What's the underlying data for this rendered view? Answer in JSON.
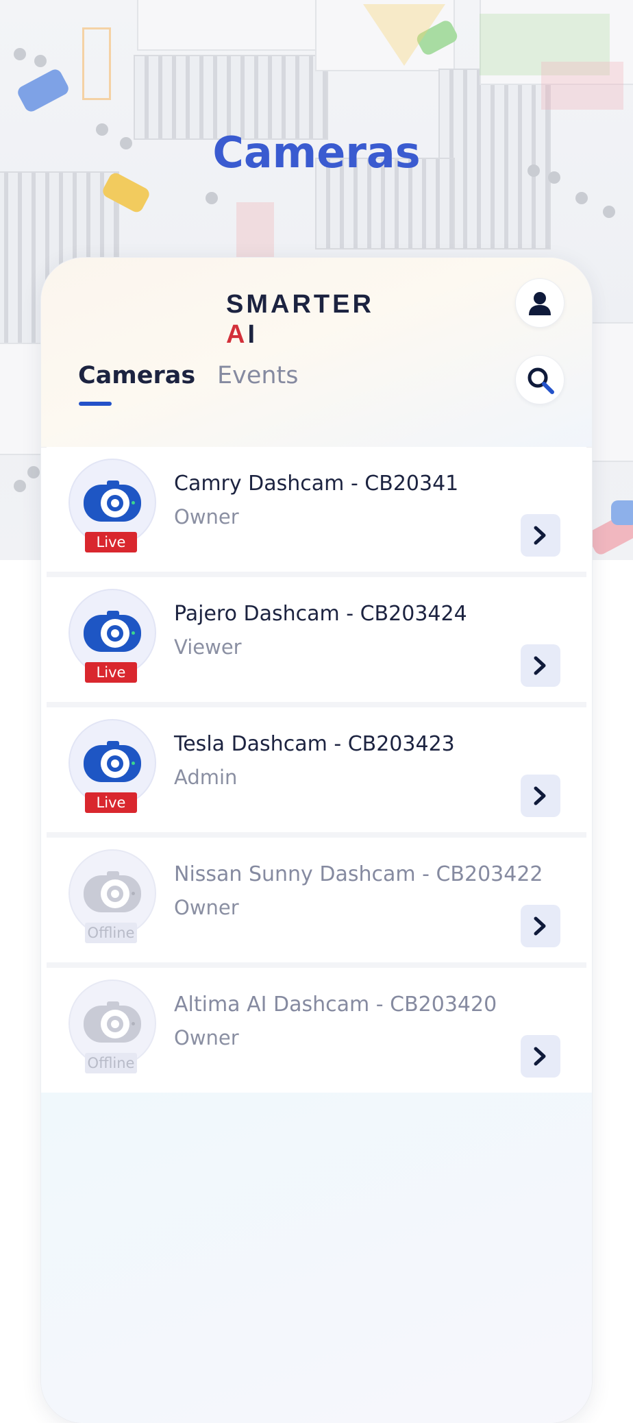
{
  "page": {
    "title": "Cameras"
  },
  "app": {
    "logo": {
      "text_a": "SMARTER ",
      "text_b": "A",
      "text_c": "I"
    },
    "tabs": [
      {
        "label": "Cameras",
        "active": true
      },
      {
        "label": "Events",
        "active": false
      }
    ]
  },
  "cameras": [
    {
      "name": "Camry Dashcam - CB20341",
      "role": "Owner",
      "status": "Live"
    },
    {
      "name": "Pajero Dashcam - CB203424",
      "role": "Viewer",
      "status": "Live"
    },
    {
      "name": "Tesla Dashcam - CB203423",
      "role": "Admin",
      "status": "Live"
    },
    {
      "name": "Nissan Sunny Dashcam - CB203422",
      "role": "Owner",
      "status": "Offline"
    },
    {
      "name": "Altima AI Dashcam - CB203420",
      "role": "Owner",
      "status": "Offline"
    }
  ],
  "colors": {
    "title": "#3a5bd0",
    "accent": "#2352c9",
    "live": "#d9272e",
    "camera_online": "#1e56c4",
    "camera_offline": "#c9cbd6"
  },
  "icons": {
    "profile": "user-icon",
    "search": "search-icon",
    "row_action": "chevron-right-icon",
    "camera": "dashcam-icon"
  }
}
